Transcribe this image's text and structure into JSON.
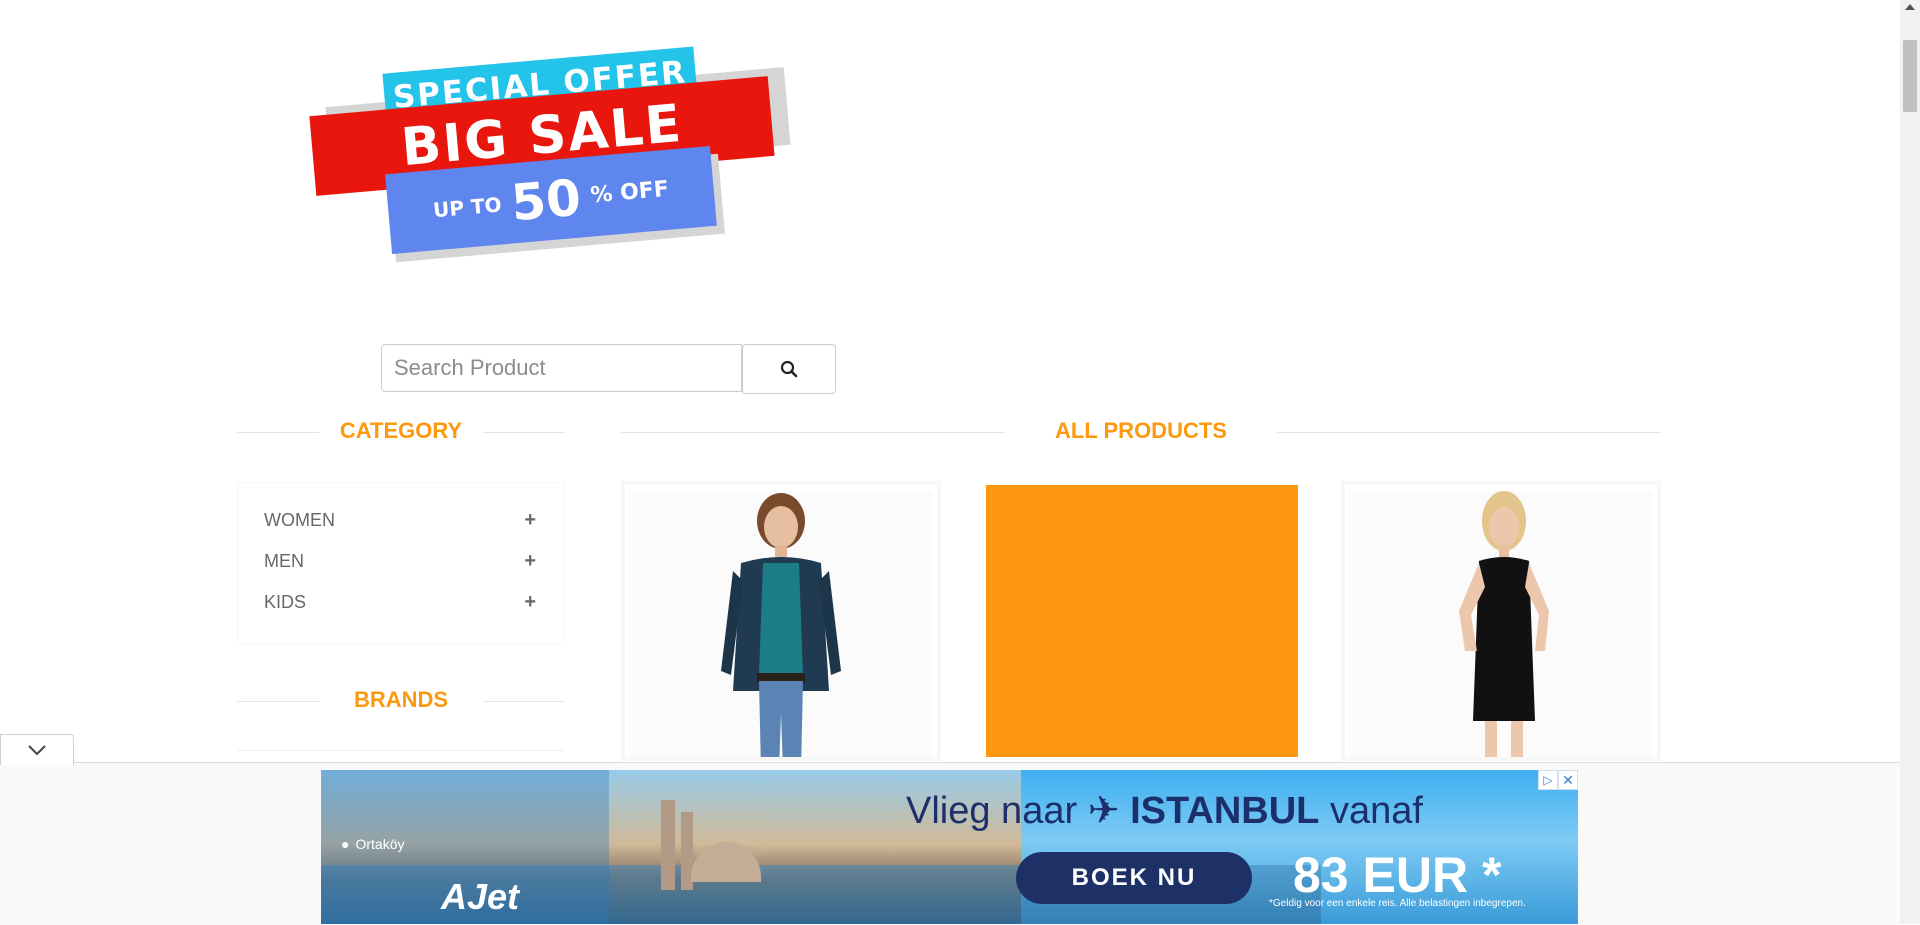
{
  "promo": {
    "line1": "SPECIAL OFFER",
    "line2": "BIG SALE",
    "up_to": "UP TO",
    "percent": "50",
    "percent_suffix": "% OFF"
  },
  "search": {
    "placeholder": "Search Product",
    "value": ""
  },
  "sidebar": {
    "category_heading": "CATEGORY",
    "categories": [
      {
        "label": "WOMEN",
        "toggle": "+"
      },
      {
        "label": "MEN",
        "toggle": "+"
      },
      {
        "label": "KIDS",
        "toggle": "+"
      }
    ],
    "brands_heading": "BRANDS"
  },
  "main": {
    "heading": "ALL PRODUCTS",
    "products": [
      {
        "image": "woman-in-cardigan-photo"
      },
      {
        "image": "orange-placeholder",
        "color": "#fe9712"
      },
      {
        "image": "woman-in-black-dress-photo"
      }
    ]
  },
  "ad": {
    "location": "Ortaköy",
    "brand": "AJet",
    "title_pre": "Vlieg naar",
    "title_city": "ISTANBUL",
    "title_post": "vanaf",
    "cta": "BOEK NU",
    "price": "83 EUR *",
    "fine_print": "*Geldig voor een enkele reis. Alle belastingen inbegrepen."
  },
  "colors": {
    "accent": "#fe980f",
    "sale_red": "#e8160c",
    "sale_cyan": "#24c4ea",
    "sale_blue": "#5f86ee",
    "ad_navy": "#1e3167"
  },
  "icons": {
    "search": "search-icon",
    "collapse": "chevron-down-icon",
    "adchoices": "adchoices-icon",
    "close": "close-icon"
  }
}
